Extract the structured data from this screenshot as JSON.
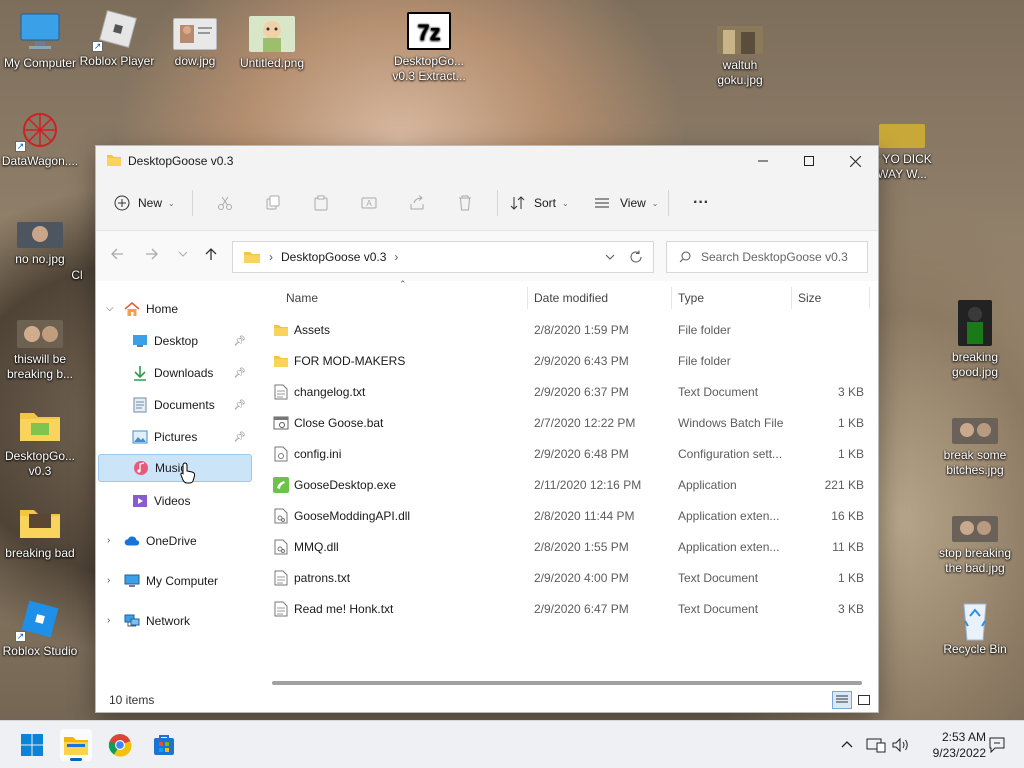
{
  "desktop": {
    "icons": [
      {
        "label": "My Computer"
      },
      {
        "label": "Roblox Player"
      },
      {
        "label": "dow.jpg"
      },
      {
        "label": "Untitled.png"
      },
      {
        "label": "DesktopGo... v0.3 Extract..."
      },
      {
        "label": "waltuh goku.jpg"
      },
      {
        "label": "DataWagon...."
      },
      {
        "label": "no no.jpg"
      },
      {
        "label": "thiswill be breaking b..."
      },
      {
        "label": "DesktopGo... v0.3"
      },
      {
        "label": "breaking bad"
      },
      {
        "label": "Roblox Studio"
      },
      {
        "label": "T YO DICK WAY W..."
      },
      {
        "label": "breaking good.jpg"
      },
      {
        "label": "break some bitches.jpg"
      },
      {
        "label": "stop breaking the bad.jpg"
      },
      {
        "label": "Recycle Bin"
      },
      {
        "label": "Cl"
      }
    ]
  },
  "window": {
    "title": "DesktopGoose v0.3",
    "toolbar": {
      "new_label": "New",
      "sort_label": "Sort",
      "view_label": "View",
      "more_label": "···"
    },
    "address": {
      "path": "DesktopGoose v0.3"
    },
    "search": {
      "placeholder": "Search DesktopGoose v0.3"
    },
    "nav": {
      "home": "Home",
      "desktop": "Desktop",
      "downloads": "Downloads",
      "documents": "Documents",
      "pictures": "Pictures",
      "music": "Music",
      "videos": "Videos",
      "onedrive": "OneDrive",
      "mycomputer": "My Computer",
      "network": "Network"
    },
    "columns": {
      "name": "Name",
      "date": "Date modified",
      "type": "Type",
      "size": "Size"
    },
    "files": [
      {
        "name": "Assets",
        "date": "2/8/2020 1:59 PM",
        "type": "File folder",
        "size": ""
      },
      {
        "name": "FOR MOD-MAKERS",
        "date": "2/9/2020 6:43 PM",
        "type": "File folder",
        "size": ""
      },
      {
        "name": "changelog.txt",
        "date": "2/9/2020 6:37 PM",
        "type": "Text Document",
        "size": "3 KB"
      },
      {
        "name": "Close Goose.bat",
        "date": "2/7/2020 12:22 PM",
        "type": "Windows Batch File",
        "size": "1 KB"
      },
      {
        "name": "config.ini",
        "date": "2/9/2020 6:48 PM",
        "type": "Configuration sett...",
        "size": "1 KB"
      },
      {
        "name": "GooseDesktop.exe",
        "date": "2/11/2020 12:16 PM",
        "type": "Application",
        "size": "221 KB"
      },
      {
        "name": "GooseModdingAPI.dll",
        "date": "2/8/2020 11:44 PM",
        "type": "Application exten...",
        "size": "16 KB"
      },
      {
        "name": "MMQ.dll",
        "date": "2/8/2020 1:55 PM",
        "type": "Application exten...",
        "size": "11 KB"
      },
      {
        "name": "patrons.txt",
        "date": "2/9/2020 4:00 PM",
        "type": "Text Document",
        "size": "1 KB"
      },
      {
        "name": "Read me! Honk.txt",
        "date": "2/9/2020 6:47 PM",
        "type": "Text Document",
        "size": "3 KB"
      }
    ],
    "status": {
      "item_count": "10 items"
    }
  },
  "taskbar": {
    "time": "2:53 AM",
    "date": "9/23/2022"
  },
  "colors": {
    "accent": "#0067c0",
    "folder": "#f4c542",
    "selection": "#cce4f7"
  }
}
